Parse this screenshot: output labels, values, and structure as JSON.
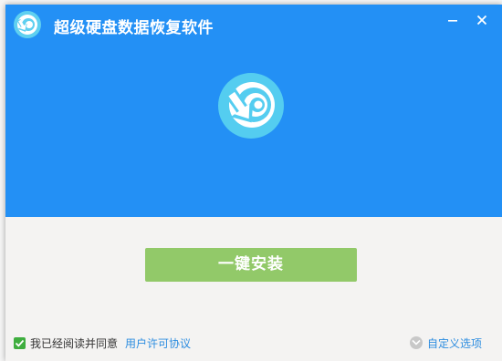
{
  "window": {
    "title": "超级硬盘数据恢复软件",
    "minimize_glyph": "—",
    "close_glyph": "✕"
  },
  "main": {
    "install_label": "一键安装"
  },
  "footer": {
    "agree_checked": true,
    "agree_text": "我已经阅读并同意",
    "license_link": "用户许可协议",
    "custom_label": "自定义选项"
  },
  "colors": {
    "header_bg": "#2390f5",
    "install_button": "#92c969",
    "link": "#2d8de0",
    "checkbox": "#3fae3f"
  },
  "icons": {
    "app_logo": "data-recovery-logo",
    "custom_options": "chevron-down-circle-icon"
  }
}
